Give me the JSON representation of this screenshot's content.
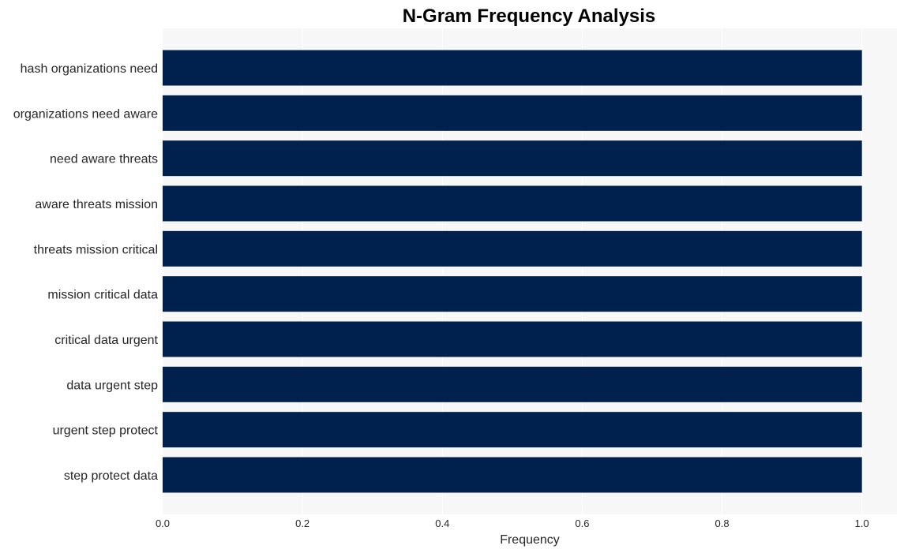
{
  "chart_data": {
    "type": "bar",
    "orientation": "horizontal",
    "title": "N-Gram Frequency Analysis",
    "xlabel": "Frequency",
    "ylabel": "",
    "categories": [
      "hash organizations need",
      "organizations need aware",
      "need aware threats",
      "aware threats mission",
      "threats mission critical",
      "mission critical data",
      "critical data urgent",
      "data urgent step",
      "urgent step protect",
      "step protect data"
    ],
    "values": [
      1,
      1,
      1,
      1,
      1,
      1,
      1,
      1,
      1,
      1
    ],
    "xlim": [
      0,
      1.05
    ],
    "xticks": [
      0.0,
      0.2,
      0.4,
      0.6,
      0.8,
      1.0
    ],
    "xtick_labels": [
      "0.0",
      "0.2",
      "0.4",
      "0.6",
      "0.8",
      "1.0"
    ],
    "grid": true,
    "legend": "none",
    "colors": {
      "bar": "#00214d",
      "plot_background": "#f7f7f7",
      "grid": "#ffffff"
    }
  }
}
